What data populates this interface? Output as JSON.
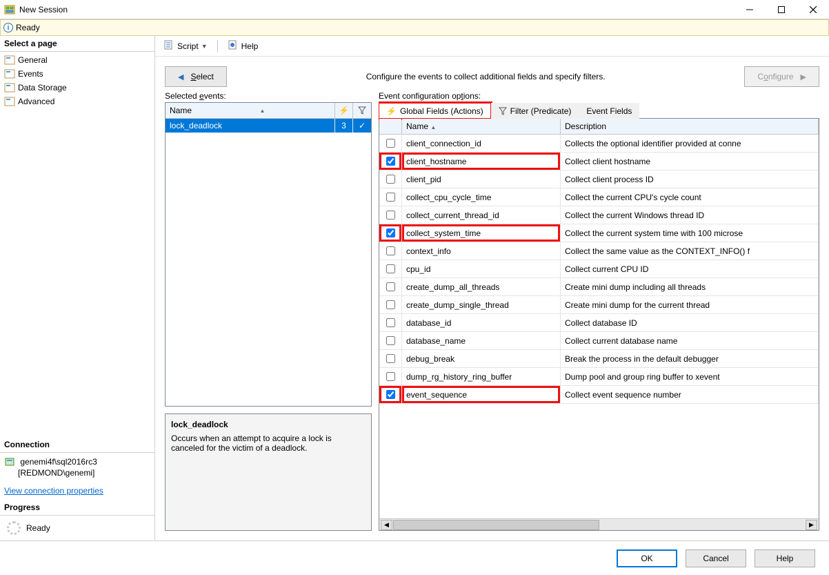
{
  "window": {
    "title": "New Session"
  },
  "status": {
    "text": "Ready"
  },
  "sidebar": {
    "select_page_label": "Select a page",
    "pages": [
      "General",
      "Events",
      "Data Storage",
      "Advanced"
    ],
    "connection_label": "Connection",
    "connection_value_line1": "genemi4f\\sql2016rc3",
    "connection_value_line2": "[REDMOND\\genemi]",
    "view_conn_props": "View connection properties",
    "progress_label": "Progress",
    "progress_status": "Ready"
  },
  "toolbar": {
    "script": "Script",
    "help": "Help"
  },
  "nav": {
    "select_label": "Select",
    "configure_label": "Configure",
    "hint": "Configure the events to collect additional fields and specify filters."
  },
  "selected_events": {
    "label": "Selected events:",
    "header_name": "Name",
    "rows": [
      {
        "name": "lock_deadlock",
        "count": "3",
        "checked": true
      }
    ]
  },
  "description": {
    "title": "lock_deadlock",
    "body": "Occurs when an attempt to acquire a lock is canceled for the victim of a deadlock."
  },
  "config": {
    "label": "Event configuration options:",
    "tabs": {
      "global": "Global Fields (Actions)",
      "filter": "Filter (Predicate)",
      "fields": "Event Fields"
    },
    "columns": {
      "name": "Name",
      "desc": "Description"
    },
    "rows": [
      {
        "checked": false,
        "name": "client_connection_id",
        "desc": "Collects the optional identifier provided at conne",
        "hl": false
      },
      {
        "checked": true,
        "name": "client_hostname",
        "desc": "Collect client hostname",
        "hl": true
      },
      {
        "checked": false,
        "name": "client_pid",
        "desc": "Collect client process ID",
        "hl": false
      },
      {
        "checked": false,
        "name": "collect_cpu_cycle_time",
        "desc": "Collect the current CPU's cycle count",
        "hl": false
      },
      {
        "checked": false,
        "name": "collect_current_thread_id",
        "desc": "Collect the current Windows thread ID",
        "hl": false
      },
      {
        "checked": true,
        "name": "collect_system_time",
        "desc": "Collect the current system time with 100 microse",
        "hl": true
      },
      {
        "checked": false,
        "name": "context_info",
        "desc": "Collect the same value as the CONTEXT_INFO() f",
        "hl": false
      },
      {
        "checked": false,
        "name": "cpu_id",
        "desc": "Collect current CPU ID",
        "hl": false
      },
      {
        "checked": false,
        "name": "create_dump_all_threads",
        "desc": "Create mini dump including all threads",
        "hl": false
      },
      {
        "checked": false,
        "name": "create_dump_single_thread",
        "desc": "Create mini dump for the current thread",
        "hl": false
      },
      {
        "checked": false,
        "name": "database_id",
        "desc": "Collect database ID",
        "hl": false
      },
      {
        "checked": false,
        "name": "database_name",
        "desc": "Collect current database name",
        "hl": false
      },
      {
        "checked": false,
        "name": "debug_break",
        "desc": "Break the process in the default debugger",
        "hl": false
      },
      {
        "checked": false,
        "name": "dump_rg_history_ring_buffer",
        "desc": "Dump pool and group ring buffer to xevent",
        "hl": false
      },
      {
        "checked": true,
        "name": "event_sequence",
        "desc": "Collect event sequence number",
        "hl": true
      }
    ]
  },
  "buttons": {
    "ok": "OK",
    "cancel": "Cancel",
    "help": "Help"
  }
}
